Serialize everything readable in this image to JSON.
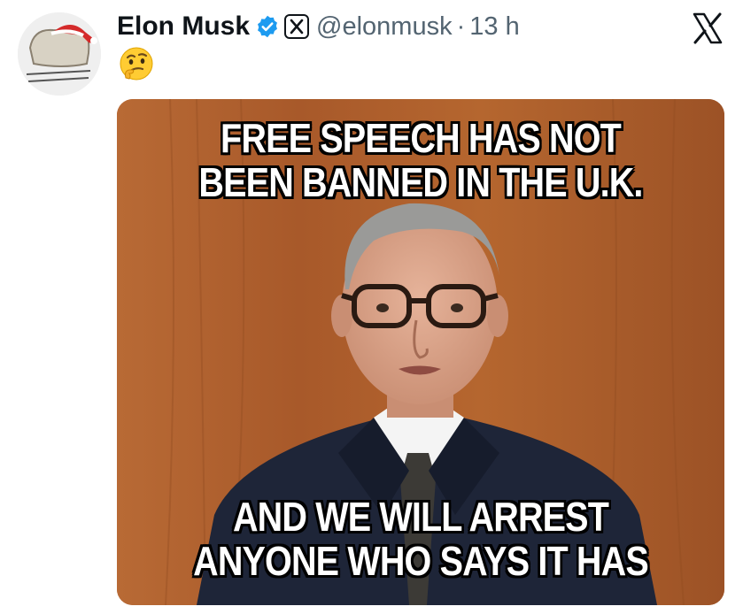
{
  "tweet": {
    "author_name": "Elon Musk",
    "handle": "@elonmusk",
    "separator": "·",
    "time": "13 h",
    "emoji": "🤔"
  },
  "meme": {
    "top_lines": [
      "FREE SPEECH HAS NOT",
      "BEEN BANNED IN THE U.K."
    ],
    "bottom_lines": [
      "AND WE WILL ARREST",
      "ANYONE WHO SAYS IT HAS"
    ]
  },
  "colors": {
    "verified": "#1d9bf0",
    "text_primary": "#0f1419",
    "text_secondary": "#536471"
  },
  "icons": [
    "verified-badge-icon",
    "x-affiliate-icon",
    "x-logo-icon",
    "thinking-face-emoji"
  ]
}
